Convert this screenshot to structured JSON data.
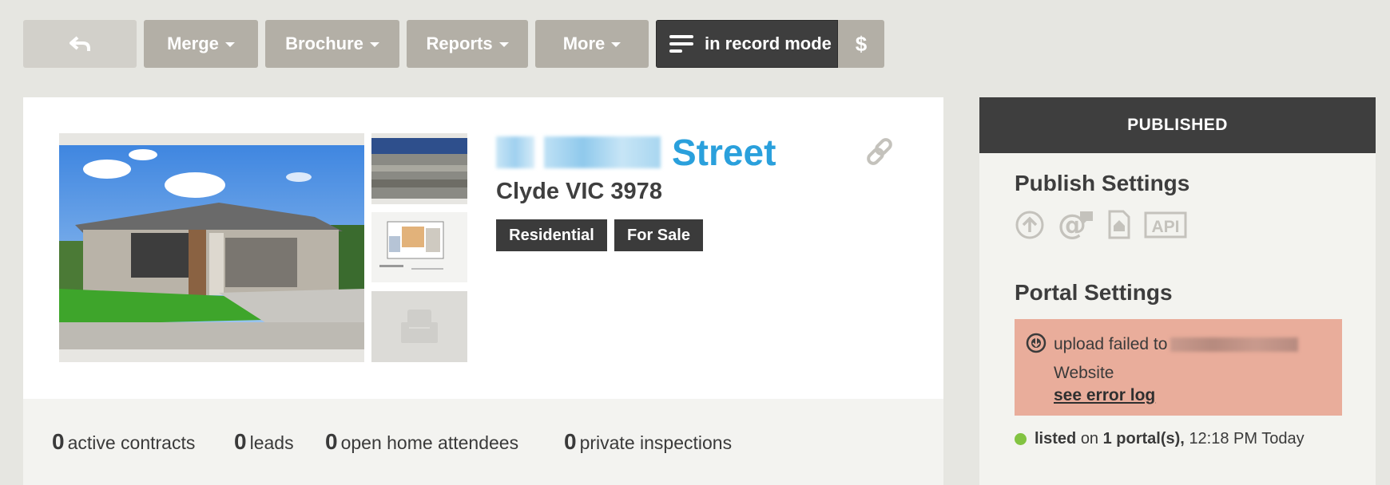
{
  "toolbar": {
    "back_icon": "back-arrow-icon",
    "merge_label": "Merge",
    "brochure_label": "Brochure",
    "reports_label": "Reports",
    "more_label": "More",
    "record_mode_label": "in record mode",
    "dollar_label": "$"
  },
  "listing": {
    "street": "Street",
    "suburb": "Clyde VIC 3978",
    "tags": [
      "Residential",
      "For Sale"
    ]
  },
  "stats": [
    {
      "count": "0",
      "label": "active contracts"
    },
    {
      "count": "0",
      "label": "leads"
    },
    {
      "count": "0",
      "label": "open home attendees"
    },
    {
      "count": "0",
      "label": "private inspections"
    }
  ],
  "panel": {
    "status": "PUBLISHED",
    "publish_heading": "Publish Settings",
    "publish_icons": [
      "upload-icon",
      "email-comment-icon",
      "home-document-icon",
      "api-icon"
    ],
    "api_label": "API",
    "portal_heading": "Portal Settings",
    "error": {
      "text": "upload failed to",
      "target_suffix": "Website",
      "link": "see error log"
    },
    "listed": {
      "status_word": "listed",
      "on": "on",
      "portals": "1 portal(s),",
      "time": "12:18 PM Today"
    }
  },
  "colors": {
    "accent_blue": "#2aa0dc",
    "status_green": "#82c341",
    "error_bg": "#e9ad9b",
    "dark": "#3e3e3e"
  }
}
